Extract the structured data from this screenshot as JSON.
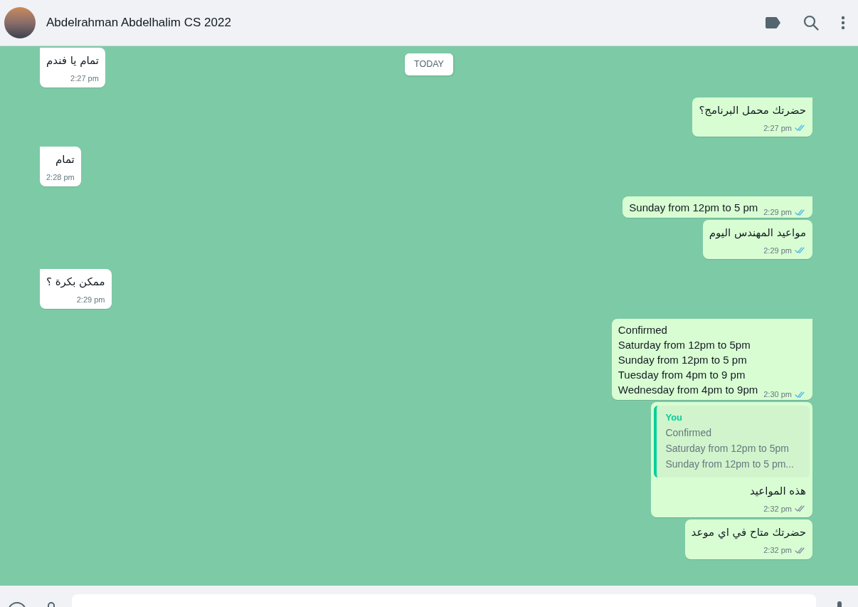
{
  "header": {
    "contact_name": "Abdelrahman Abdelhalim CS 2022"
  },
  "date_badge": "TODAY",
  "messages": [
    {
      "kind": "text",
      "outgoing": false,
      "rtl": true,
      "lines": [
        "تمام يا فندم"
      ],
      "time": "2:27 pm"
    },
    {
      "kind": "text",
      "outgoing": true,
      "rtl": true,
      "lines": [
        "حضرتك محمل البرنامج؟"
      ],
      "time": "2:27 pm",
      "read": true
    },
    {
      "kind": "text",
      "outgoing": false,
      "rtl": true,
      "lines": [
        "تمام"
      ],
      "time": "2:28 pm"
    },
    {
      "kind": "text",
      "outgoing": true,
      "rtl": false,
      "lines": [
        "Sunday from 12pm to 5 pm"
      ],
      "time": "2:29 pm",
      "read": true
    },
    {
      "kind": "text",
      "outgoing": true,
      "rtl": true,
      "lines": [
        "مواعيد المهندس اليوم"
      ],
      "time": "2:29 pm",
      "read": true
    },
    {
      "kind": "text",
      "outgoing": false,
      "rtl": true,
      "lines": [
        "ممكن بكرة ؟"
      ],
      "time": "2:29 pm"
    },
    {
      "kind": "text",
      "outgoing": true,
      "rtl": false,
      "lines": [
        "Confirmed",
        "Saturday from 12pm to 5pm",
        "Sunday from 12pm to 5 pm",
        "Tuesday from 4pm to 9 pm",
        "Wednesday from 4pm to 9pm"
      ],
      "time": "2:30 pm",
      "read": true
    },
    {
      "kind": "reply",
      "outgoing": true,
      "rtl": true,
      "quote": {
        "author": "You",
        "lines": [
          "Confirmed",
          "Saturday from 12pm to 5pm",
          "Sunday from 12pm to 5 pm..."
        ]
      },
      "lines": [
        "هذه المواعيد"
      ],
      "time": "2:32 pm",
      "read": false
    },
    {
      "kind": "text",
      "outgoing": true,
      "rtl": true,
      "lines": [
        "حضرتك متاح في اي موعد"
      ],
      "time": "2:32 pm",
      "read": false
    }
  ]
}
